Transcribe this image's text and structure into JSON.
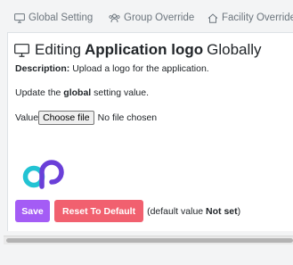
{
  "tabs": {
    "global": "Global Setting",
    "group": "Group Override",
    "facility": "Facility Override"
  },
  "heading": {
    "prefix": "Editing",
    "name": "Application logo",
    "suffix": "Globally"
  },
  "description": {
    "label": "Description:",
    "text": "Upload a logo for the application."
  },
  "update": {
    "prefix": "Update the",
    "emphasis": "global",
    "suffix": "setting value."
  },
  "value_field": {
    "label": "Value",
    "button": "Choose file",
    "status": "No file chosen"
  },
  "actions": {
    "save": "Save",
    "reset": "Reset To Default"
  },
  "default_note": {
    "prefix": "(default value",
    "value": "Not set",
    "suffix": ")"
  },
  "colors": {
    "save": "#a45cf5",
    "reset": "#f1606f",
    "logo_teal": "#22c3d3",
    "logo_purple": "#6a3fd8"
  },
  "icons": {
    "global_tab": "monitor-icon",
    "group_tab": "users-icon",
    "facility_tab": "home-icon",
    "heading": "monitor-icon"
  }
}
